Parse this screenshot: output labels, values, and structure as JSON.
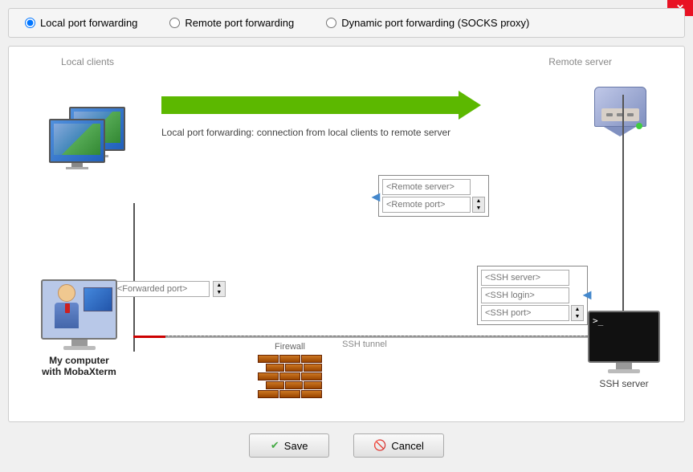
{
  "window": {
    "close_label": "✕"
  },
  "radio_options": {
    "local": "Local port forwarding",
    "remote": "Remote port forwarding",
    "dynamic": "Dynamic port forwarding (SOCKS proxy)"
  },
  "diagram": {
    "label_local_clients": "Local clients",
    "label_remote_server": "Remote server",
    "description": "Local port forwarding: connection from local clients to remote server",
    "remote_server_placeholder": "<Remote server>",
    "remote_port_placeholder": "<Remote port>",
    "forwarded_port_placeholder": "<Forwarded port>",
    "ssh_server_placeholder": "<SSH server>",
    "ssh_login_placeholder": "<SSH login>",
    "ssh_port_placeholder": "<SSH port>",
    "firewall_label": "Firewall",
    "ssh_tunnel_label": "SSH tunnel",
    "my_computer_label": "My computer\nwith MobaXterm",
    "ssh_server_label": "SSH server"
  },
  "buttons": {
    "save_label": "Save",
    "save_icon": "✔",
    "cancel_label": "Cancel",
    "cancel_icon": "🚫"
  }
}
